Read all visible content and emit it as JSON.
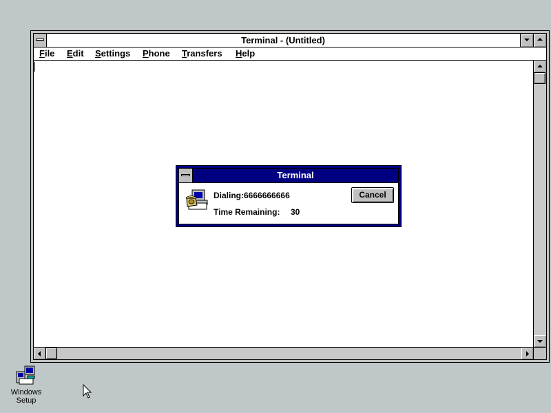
{
  "window": {
    "title": "Terminal - (Untitled)",
    "menu": [
      {
        "u": "F",
        "rest": "ile"
      },
      {
        "u": "E",
        "rest": "dit"
      },
      {
        "u": "S",
        "rest": "ettings"
      },
      {
        "u": "P",
        "rest": "hone"
      },
      {
        "u": "T",
        "rest": "ransfers"
      },
      {
        "u": "H",
        "rest": "elp"
      }
    ]
  },
  "dialog": {
    "title": "Terminal",
    "dialing_text": "Dialing:6666666666",
    "time_label": "Time Remaining:",
    "time_value": "30",
    "cancel_label": "Cancel",
    "icon": "telephone-computer-icon"
  },
  "desktop": {
    "icon_label_line1": "Windows",
    "icon_label_line2": "Setup",
    "icon": "windows-setup-icon"
  },
  "colors": {
    "desktop": "#c0c7c8",
    "active_title": "#000080",
    "chrome": "#c0c0c0"
  }
}
